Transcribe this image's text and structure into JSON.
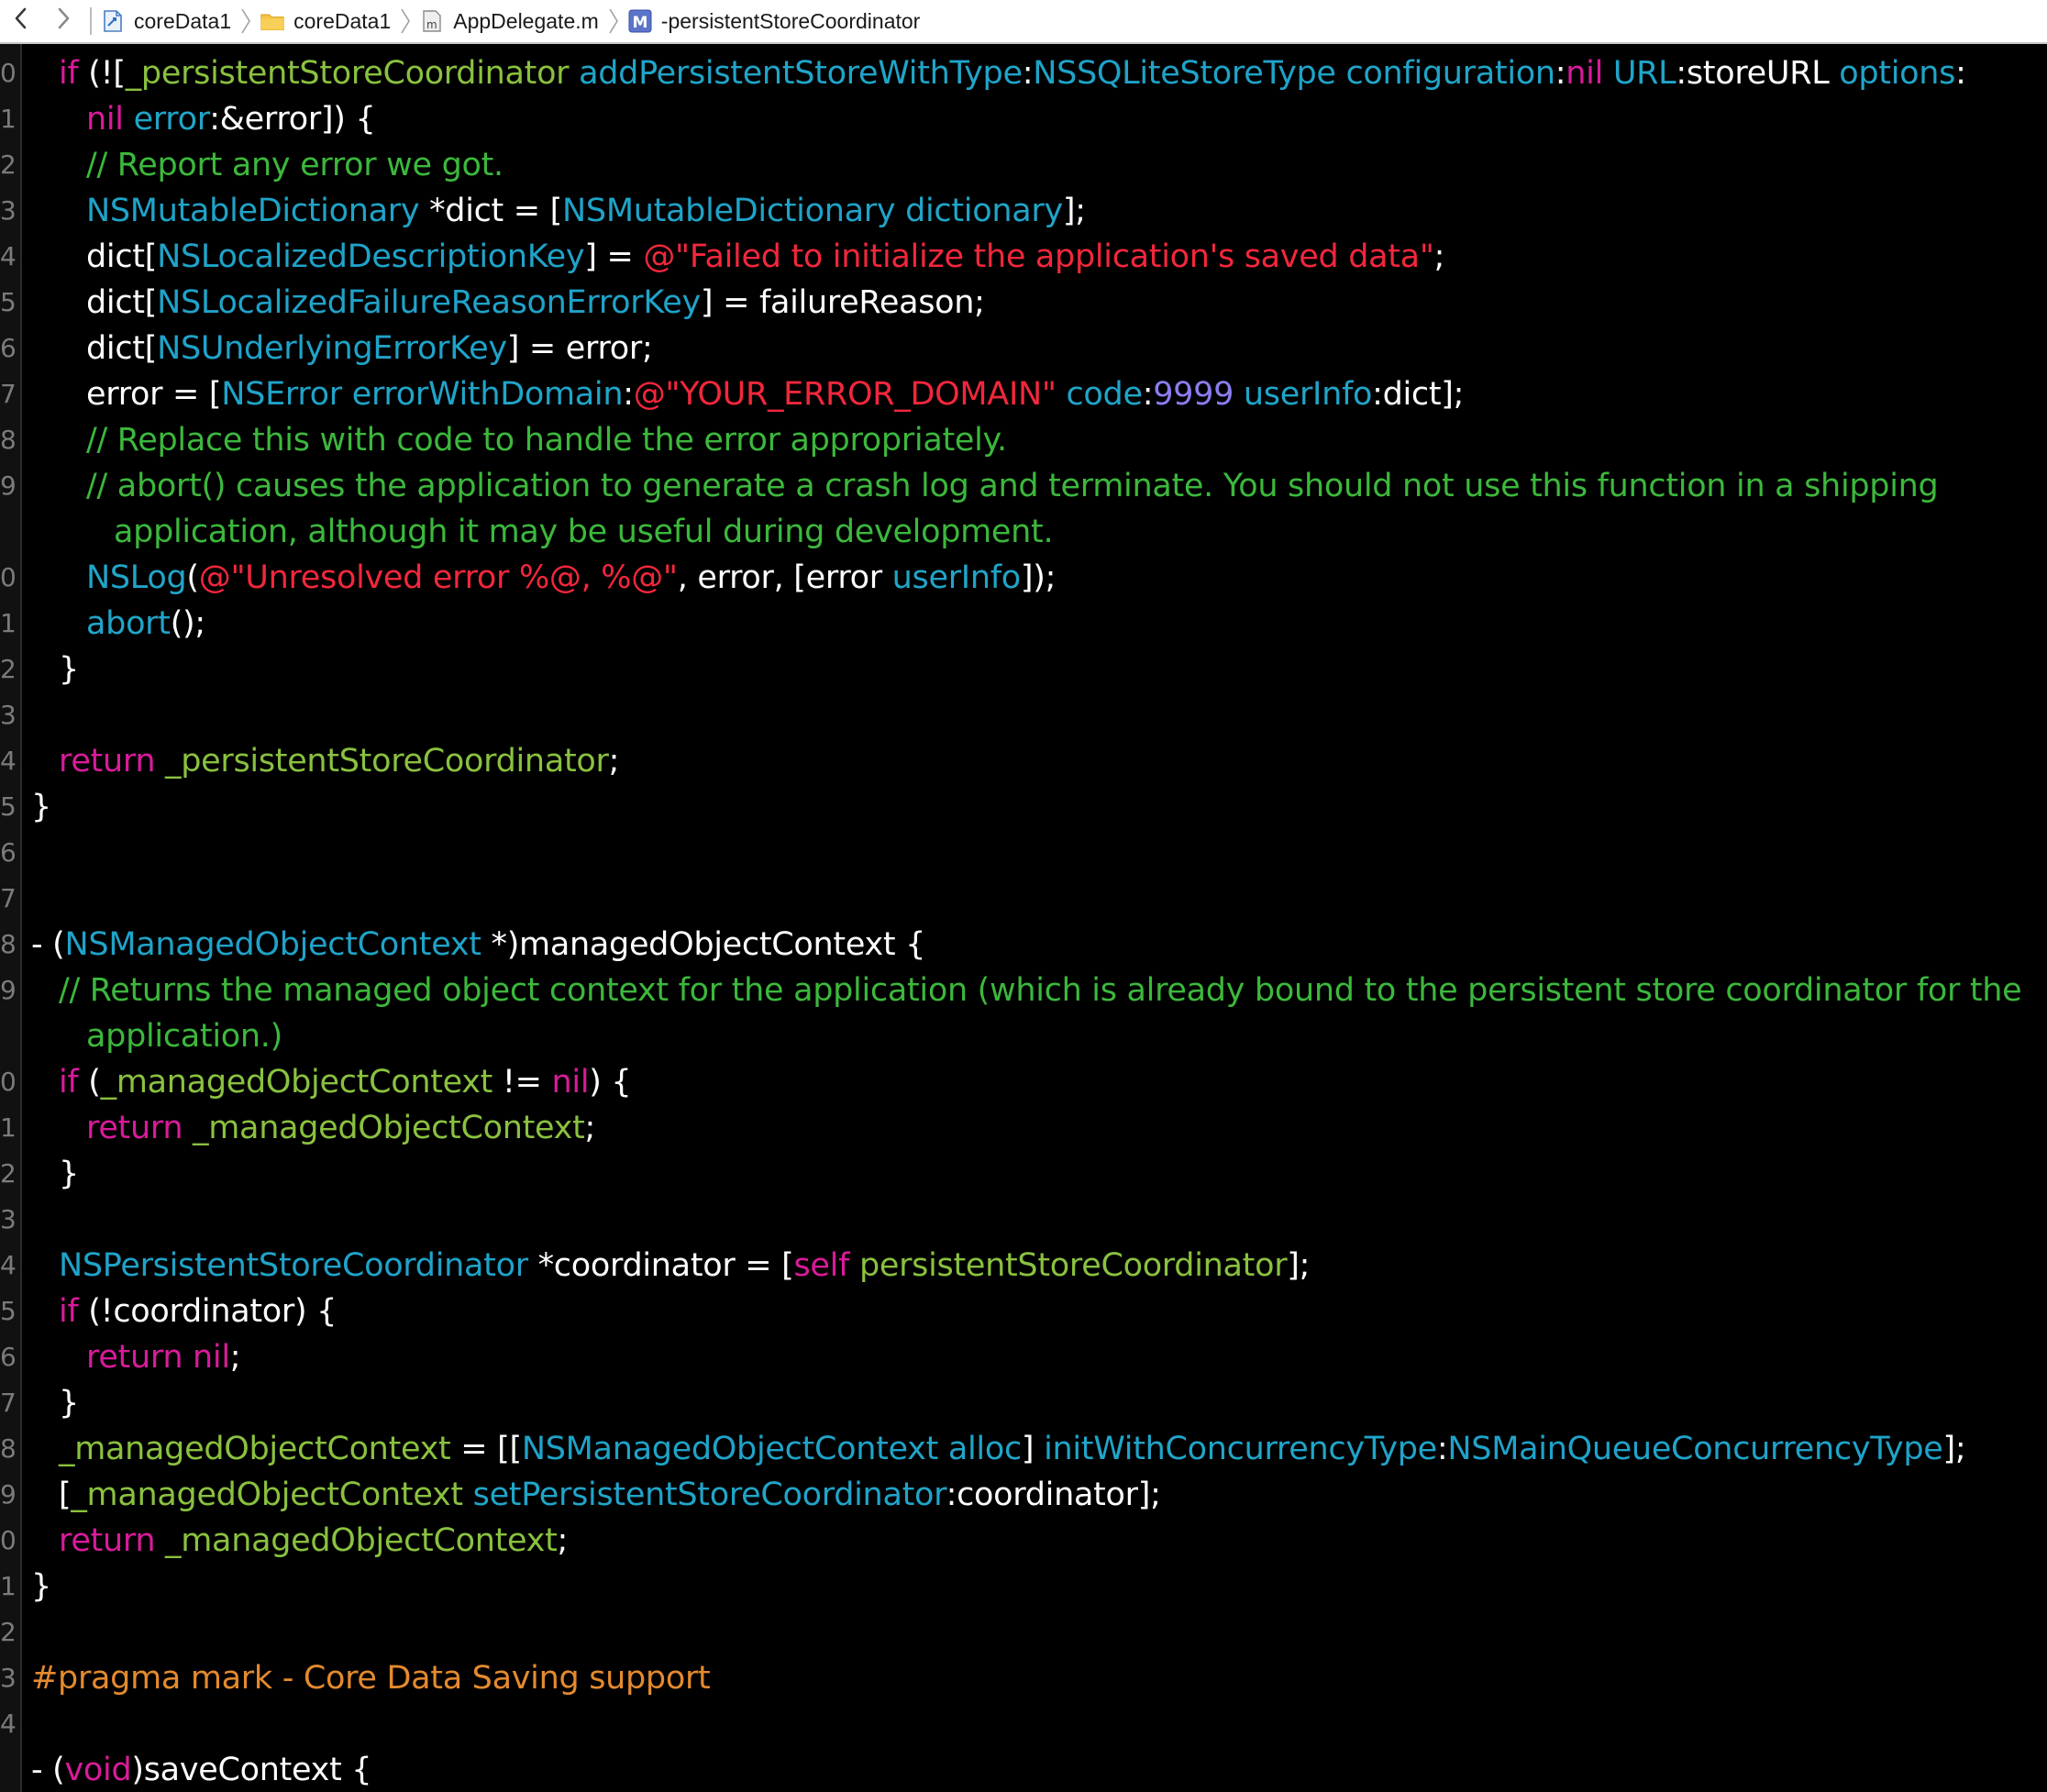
{
  "jumpbar": {
    "back_icon": "chevron-left-icon",
    "forward_icon": "chevron-right-icon",
    "crumbs": [
      {
        "label": "coreData1",
        "icon": "xcode-project-icon"
      },
      {
        "label": "coreData1",
        "icon": "folder-icon"
      },
      {
        "label": "AppDelegate.m",
        "icon": "objc-file-icon"
      },
      {
        "label": "-persistentStoreCoordinator",
        "icon": "method-icon"
      }
    ]
  },
  "gutter": {
    "line_numbers": [
      "0",
      "1",
      "2",
      "3",
      "4",
      "5",
      "6",
      "7",
      "8",
      "9",
      "0",
      "1",
      "2",
      "3",
      "4",
      "5",
      "6",
      "7",
      "8",
      "9",
      "0",
      "1",
      "2",
      "3",
      "4",
      "5",
      "6",
      "7",
      "8",
      "9",
      "0",
      "1",
      "2",
      "3",
      "4"
    ]
  },
  "colors": {
    "keyword": "#d91b9a",
    "class": "#1fa3c9",
    "method": "#20a5c9",
    "property": "#8ac13f",
    "comment": "#3cb83c",
    "string": "#f2273c",
    "number": "#8a7ef0",
    "preprocessor": "#e48a2e",
    "plain": "#ffffff",
    "background": "#000000"
  },
  "code": {
    "lines": [
      {
        "indent": 1,
        "tokens": [
          [
            "kw",
            "if"
          ],
          [
            "pl",
            " (!["
          ],
          [
            "prop",
            "_persistentStoreCoordinator"
          ],
          [
            "pl",
            " "
          ],
          [
            "meth",
            "addPersistentStoreWithType"
          ],
          [
            "pl",
            ":"
          ],
          [
            "cls",
            "NSSQLiteStoreType"
          ],
          [
            "pl",
            " "
          ],
          [
            "meth",
            "configuration"
          ],
          [
            "pl",
            ":"
          ],
          [
            "kw",
            "nil"
          ],
          [
            "pl",
            " "
          ],
          [
            "meth",
            "URL"
          ],
          [
            "pl",
            ":storeURL "
          ],
          [
            "meth",
            "options"
          ],
          [
            "pl",
            ":"
          ]
        ]
      },
      {
        "indent": 2,
        "tokens": [
          [
            "kw",
            "nil"
          ],
          [
            "pl",
            " "
          ],
          [
            "meth",
            "error"
          ],
          [
            "pl",
            ":&error]) {"
          ]
        ]
      },
      {
        "indent": 2,
        "tokens": [
          [
            "cm",
            "// Report any error we got."
          ]
        ]
      },
      {
        "indent": 2,
        "tokens": [
          [
            "cls",
            "NSMutableDictionary"
          ],
          [
            "pl",
            " *dict = ["
          ],
          [
            "cls",
            "NSMutableDictionary"
          ],
          [
            "pl",
            " "
          ],
          [
            "meth",
            "dictionary"
          ],
          [
            "pl",
            "];"
          ]
        ]
      },
      {
        "indent": 2,
        "tokens": [
          [
            "pl",
            "dict["
          ],
          [
            "cls",
            "NSLocalizedDescriptionKey"
          ],
          [
            "pl",
            "] = "
          ],
          [
            "str",
            "@\"Failed to initialize the application's saved data\""
          ],
          [
            "pl",
            ";"
          ]
        ]
      },
      {
        "indent": 2,
        "tokens": [
          [
            "pl",
            "dict["
          ],
          [
            "cls",
            "NSLocalizedFailureReasonErrorKey"
          ],
          [
            "pl",
            "] = failureReason;"
          ]
        ]
      },
      {
        "indent": 2,
        "tokens": [
          [
            "pl",
            "dict["
          ],
          [
            "cls",
            "NSUnderlyingErrorKey"
          ],
          [
            "pl",
            "] = error;"
          ]
        ]
      },
      {
        "indent": 2,
        "tokens": [
          [
            "pl",
            "error = ["
          ],
          [
            "cls",
            "NSError"
          ],
          [
            "pl",
            " "
          ],
          [
            "meth",
            "errorWithDomain"
          ],
          [
            "pl",
            ":"
          ],
          [
            "str",
            "@\"YOUR_ERROR_DOMAIN\""
          ],
          [
            "pl",
            " "
          ],
          [
            "meth",
            "code"
          ],
          [
            "pl",
            ":"
          ],
          [
            "num",
            "9999"
          ],
          [
            "pl",
            " "
          ],
          [
            "meth",
            "userInfo"
          ],
          [
            "pl",
            ":dict];"
          ]
        ]
      },
      {
        "indent": 2,
        "tokens": [
          [
            "cm",
            "// Replace this with code to handle the error appropriately."
          ]
        ]
      },
      {
        "indent": 2,
        "tokens": [
          [
            "cm",
            "// abort() causes the application to generate a crash log and terminate. You should not use this function in a shipping"
          ]
        ]
      },
      {
        "indent": 3,
        "tokens": [
          [
            "cm",
            "application, although it may be useful during development."
          ]
        ]
      },
      {
        "indent": 2,
        "tokens": [
          [
            "meth",
            "NSLog"
          ],
          [
            "pl",
            "("
          ],
          [
            "str",
            "@\"Unresolved error %@, %@\""
          ],
          [
            "pl",
            ", error, [error "
          ],
          [
            "meth",
            "userInfo"
          ],
          [
            "pl",
            "]);"
          ]
        ]
      },
      {
        "indent": 2,
        "tokens": [
          [
            "meth",
            "abort"
          ],
          [
            "pl",
            "();"
          ]
        ]
      },
      {
        "indent": 1,
        "tokens": [
          [
            "pl",
            "}"
          ]
        ]
      },
      {
        "indent": 0,
        "tokens": []
      },
      {
        "indent": 1,
        "tokens": [
          [
            "kw",
            "return"
          ],
          [
            "pl",
            " "
          ],
          [
            "prop",
            "_persistentStoreCoordinator"
          ],
          [
            "pl",
            ";"
          ]
        ]
      },
      {
        "indent": 0,
        "tokens": [
          [
            "pl",
            "}"
          ]
        ]
      },
      {
        "indent": 0,
        "tokens": []
      },
      {
        "indent": 0,
        "tokens": []
      },
      {
        "indent": 0,
        "tokens": [
          [
            "pl",
            "- ("
          ],
          [
            "cls",
            "NSManagedObjectContext"
          ],
          [
            "pl",
            " *)managedObjectContext {"
          ]
        ]
      },
      {
        "indent": 1,
        "tokens": [
          [
            "cm",
            "// Returns the managed object context for the application (which is already bound to the persistent store coordinator for the"
          ]
        ]
      },
      {
        "indent": 2,
        "tokens": [
          [
            "cm",
            "application.)"
          ]
        ]
      },
      {
        "indent": 1,
        "tokens": [
          [
            "kw",
            "if"
          ],
          [
            "pl",
            " ("
          ],
          [
            "prop",
            "_managedObjectContext"
          ],
          [
            "pl",
            " != "
          ],
          [
            "kw",
            "nil"
          ],
          [
            "pl",
            ") {"
          ]
        ]
      },
      {
        "indent": 2,
        "tokens": [
          [
            "kw",
            "return"
          ],
          [
            "pl",
            " "
          ],
          [
            "prop",
            "_managedObjectContext"
          ],
          [
            "pl",
            ";"
          ]
        ]
      },
      {
        "indent": 1,
        "tokens": [
          [
            "pl",
            "}"
          ]
        ]
      },
      {
        "indent": 0,
        "tokens": []
      },
      {
        "indent": 1,
        "tokens": [
          [
            "cls",
            "NSPersistentStoreCoordinator"
          ],
          [
            "pl",
            " *coordinator = ["
          ],
          [
            "kw",
            "self"
          ],
          [
            "pl",
            " "
          ],
          [
            "prop",
            "persistentStoreCoordinator"
          ],
          [
            "pl",
            "];"
          ]
        ]
      },
      {
        "indent": 1,
        "tokens": [
          [
            "kw",
            "if"
          ],
          [
            "pl",
            " (!coordinator) {"
          ]
        ]
      },
      {
        "indent": 2,
        "tokens": [
          [
            "kw",
            "return"
          ],
          [
            "pl",
            " "
          ],
          [
            "kw",
            "nil"
          ],
          [
            "pl",
            ";"
          ]
        ]
      },
      {
        "indent": 1,
        "tokens": [
          [
            "pl",
            "}"
          ]
        ]
      },
      {
        "indent": 1,
        "tokens": [
          [
            "prop",
            "_managedObjectContext"
          ],
          [
            "pl",
            " = [["
          ],
          [
            "cls",
            "NSManagedObjectContext"
          ],
          [
            "pl",
            " "
          ],
          [
            "meth",
            "alloc"
          ],
          [
            "pl",
            "] "
          ],
          [
            "meth",
            "initWithConcurrencyType"
          ],
          [
            "pl",
            ":"
          ],
          [
            "cls",
            "NSMainQueueConcurrencyType"
          ],
          [
            "pl",
            "];"
          ]
        ]
      },
      {
        "indent": 1,
        "tokens": [
          [
            "pl",
            "["
          ],
          [
            "prop",
            "_managedObjectContext"
          ],
          [
            "pl",
            " "
          ],
          [
            "meth",
            "setPersistentStoreCoordinator"
          ],
          [
            "pl",
            ":coordinator];"
          ]
        ]
      },
      {
        "indent": 1,
        "tokens": [
          [
            "kw",
            "return"
          ],
          [
            "pl",
            " "
          ],
          [
            "prop",
            "_managedObjectContext"
          ],
          [
            "pl",
            ";"
          ]
        ]
      },
      {
        "indent": 0,
        "tokens": [
          [
            "pl",
            "}"
          ]
        ]
      },
      {
        "indent": 0,
        "tokens": []
      },
      {
        "indent": 0,
        "tokens": [
          [
            "pre",
            "#pragma mark - Core Data Saving support"
          ]
        ]
      },
      {
        "indent": 0,
        "tokens": []
      },
      {
        "indent": 0,
        "tokens": [
          [
            "pl",
            "- ("
          ],
          [
            "kw",
            "void"
          ],
          [
            "pl",
            ")saveContext {"
          ]
        ]
      }
    ]
  }
}
